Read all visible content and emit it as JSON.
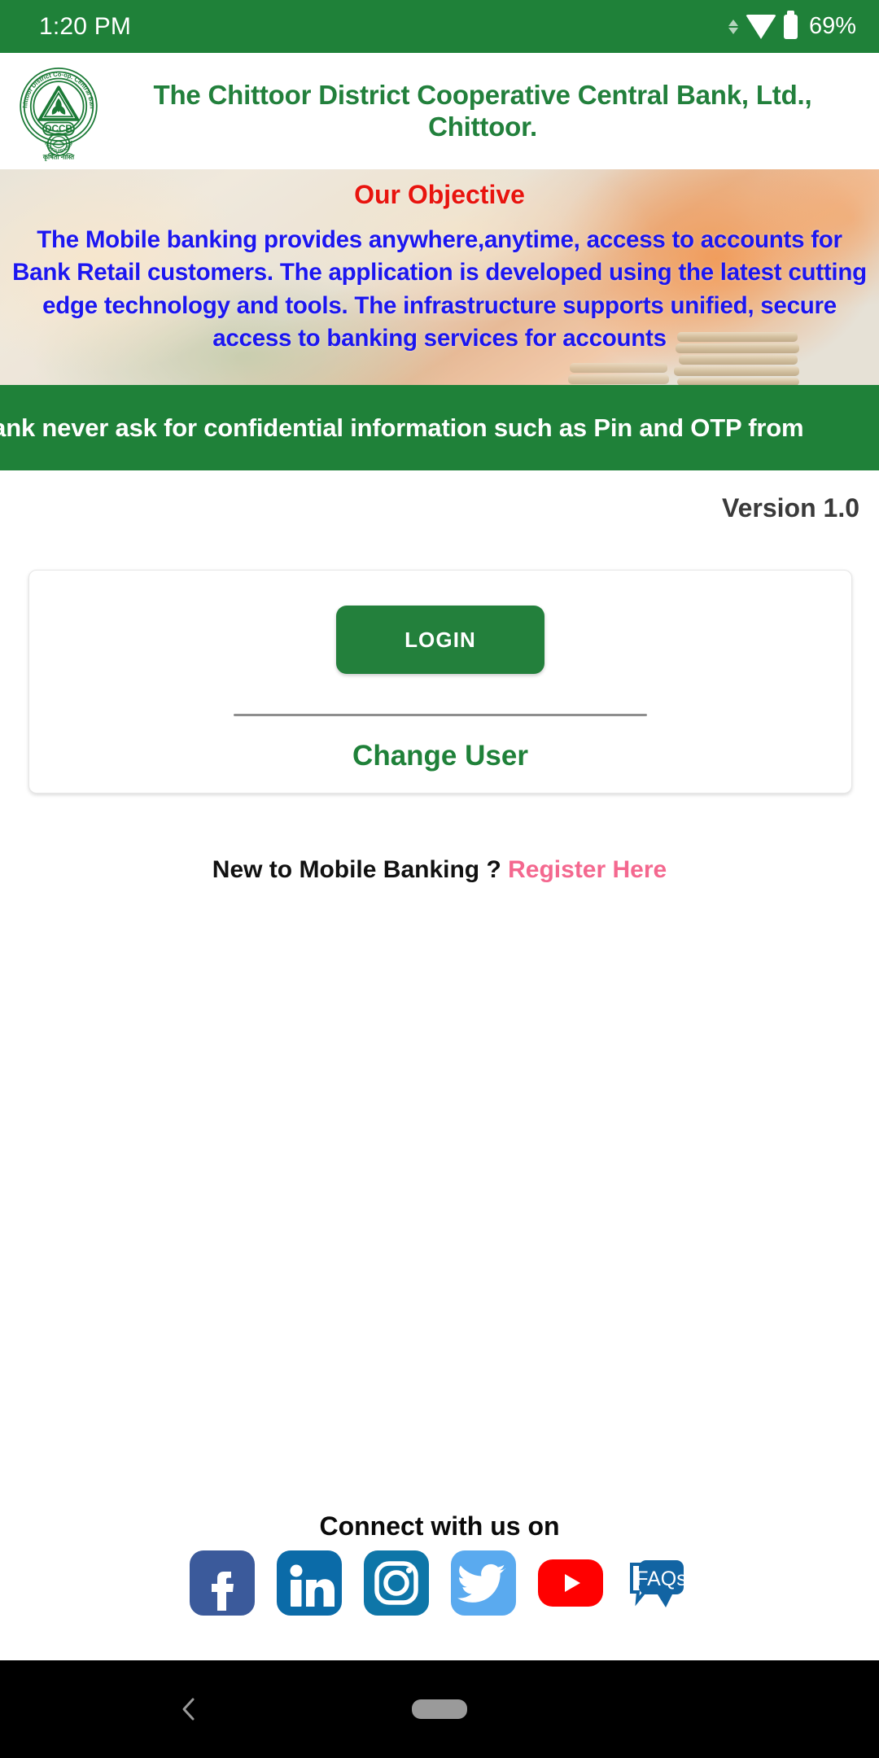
{
  "status_bar": {
    "time": "1:20 PM",
    "battery_percent": "69%",
    "icons": [
      "data-transfer-arrows-icon",
      "wifi-icon",
      "battery-icon"
    ]
  },
  "header": {
    "bank_title": "The Chittoor District Cooperative Central Bank, Ltd., Chittoor.",
    "logo_outer_text": "The Chittoor District Co-op. Central Bank Ltd.",
    "logo_center_text": "DCCB",
    "logo_state_text": "ANDHRA PRADESH",
    "brand_green": "#22803c"
  },
  "objective": {
    "title": "Our Objective",
    "title_color": "#e8140e",
    "body": "The Mobile banking provides anywhere,anytime,  access to accounts for Bank Retail customers. The application is developed using the latest cutting edge technology and tools. The infrastructure supports unified, secure access to banking services for accounts",
    "body_color": "#1c16f0"
  },
  "marquee": {
    "text": "Bank never ask for confidential information such as Pin and OTP from",
    "background": "#1f8139"
  },
  "version": {
    "label": "Version 1.0"
  },
  "login_card": {
    "login_label": "LOGIN",
    "login_color": "#23803c",
    "change_user_label": "Change User",
    "change_user_color": "#1f8139"
  },
  "register": {
    "question": "New to Mobile Banking ? ",
    "link_label": "Register Here",
    "link_color": "#f4688f"
  },
  "footer": {
    "connect_title": "Connect with us on",
    "socials": [
      {
        "name": "facebook-icon",
        "label": "Facebook",
        "color": "#3b5a9b"
      },
      {
        "name": "linkedin-icon",
        "label": "LinkedIn",
        "color": "#0b6ba8"
      },
      {
        "name": "instagram-icon",
        "label": "Instagram",
        "color": "#0e76a8"
      },
      {
        "name": "twitter-icon",
        "label": "Twitter",
        "color": "#5aaaef"
      },
      {
        "name": "youtube-icon",
        "label": "YouTube",
        "color": "#ff0000"
      },
      {
        "name": "faqs-icon",
        "label": "FAQs",
        "color": "#1264a3"
      }
    ]
  },
  "navbar": {
    "back_label": "Back",
    "home_label": "Home"
  }
}
